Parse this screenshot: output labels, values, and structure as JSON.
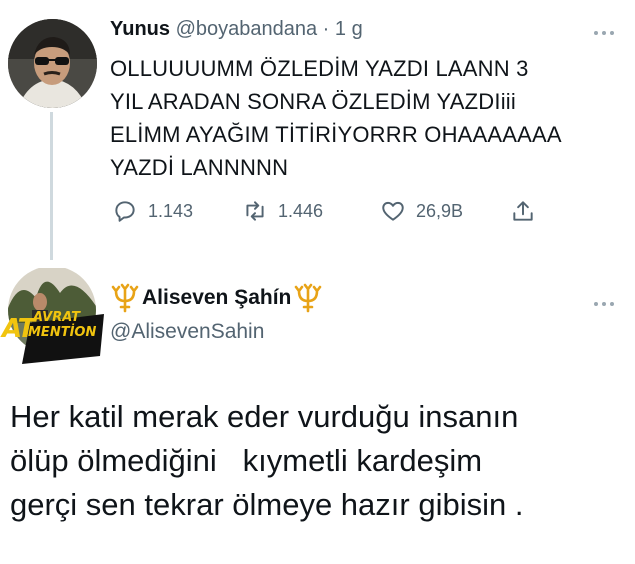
{
  "tweet1": {
    "display_name": "Yunus",
    "handle": "@boyabandana",
    "separator": " · ",
    "time": "1 g",
    "text_lines": [
      "OLLUUUUMM ÖZLEDİM YAZDI LAANN 3",
      "YIL ARADAN SONRA ÖZLEDİM YAZDIiii",
      "ELİMM AYAĞIM TİTİRİYORRR OHAAAAAAA",
      "YAZDİ LANNNNN"
    ],
    "actions": {
      "reply_count": "1.143",
      "retweet_count": "1.446",
      "like_count": "26,9B"
    }
  },
  "tweet2": {
    "display_name": "Aliseven Şahín",
    "handle": "@AlisevenSahin",
    "avatar_badge_line1": "AVRAT",
    "avatar_badge_line2": "MENTİON",
    "avatar_badge_prefix": "AT",
    "text": "Her katil merak eder vurduğu insanın\nölüp ölmediğini   kıymetli kardeşim\ngerçi sen tekrar ölmeye hazır gibisin ."
  },
  "icons": {
    "reply": "speech-bubble-icon",
    "retweet": "retweet-icon",
    "like": "heart-icon",
    "share": "share-icon",
    "more": "more-dots-icon",
    "name_emoji": "trident-icon"
  },
  "colors": {
    "text": "#0f1419",
    "muted": "#536471",
    "thread_line": "#cfd9de",
    "trident": "#e8a317"
  }
}
